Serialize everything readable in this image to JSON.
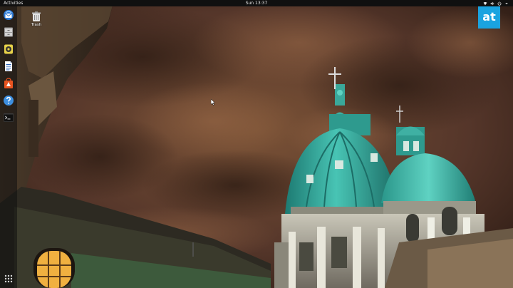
{
  "topbar": {
    "activities_label": "Activities",
    "clock": "Sun 13:37",
    "status_icons": [
      "network-icon",
      "volume-icon",
      "power-icon",
      "system-menu-arrow-icon"
    ]
  },
  "dock": {
    "items": [
      {
        "name": "thunderbird-mail",
        "icon": "mail-bird-icon"
      },
      {
        "name": "files",
        "icon": "file-cabinet-icon"
      },
      {
        "name": "rhythmbox",
        "icon": "music-speaker-icon"
      },
      {
        "name": "libreoffice-writer",
        "icon": "document-icon"
      },
      {
        "name": "ubuntu-software",
        "icon": "software-bag-icon"
      },
      {
        "name": "help",
        "icon": "help-icon"
      },
      {
        "name": "terminal",
        "icon": "terminal-icon"
      }
    ],
    "show_apps_icon": "app-grid-icon"
  },
  "desktop": {
    "trash_label": "Trash",
    "trash_icon": "trash-icon"
  },
  "watermark": {
    "logo_text": "at",
    "logo_color": "#1aa3e0"
  },
  "wallpaper": {
    "sky_color": "#5a3a26",
    "dome_color": "#3fb0a3"
  }
}
